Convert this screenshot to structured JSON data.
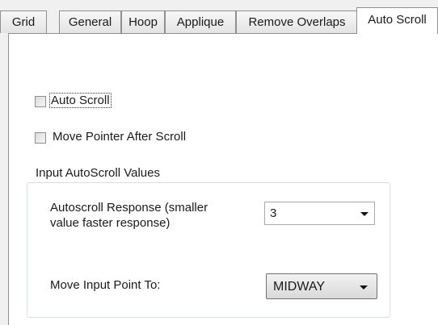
{
  "tabs": [
    {
      "label": "Grid"
    },
    {
      "label": "General"
    },
    {
      "label": "Hoop"
    },
    {
      "label": "Applique"
    },
    {
      "label": "Remove Overlaps"
    },
    {
      "label": "Auto Scroll"
    }
  ],
  "active_tab": "Auto Scroll",
  "options": {
    "auto_scroll": {
      "label": "Auto Scroll",
      "checked": false
    },
    "move_pointer": {
      "label": "Move Pointer After Scroll",
      "checked": false
    }
  },
  "group": {
    "title": "Input AutoScroll Values",
    "response": {
      "label_line1": "Autoscroll Response (smaller",
      "label_line2": "value faster response)",
      "value": "3"
    },
    "move_point": {
      "label": "Move Input Point To:",
      "value": "MIDWAY"
    }
  }
}
